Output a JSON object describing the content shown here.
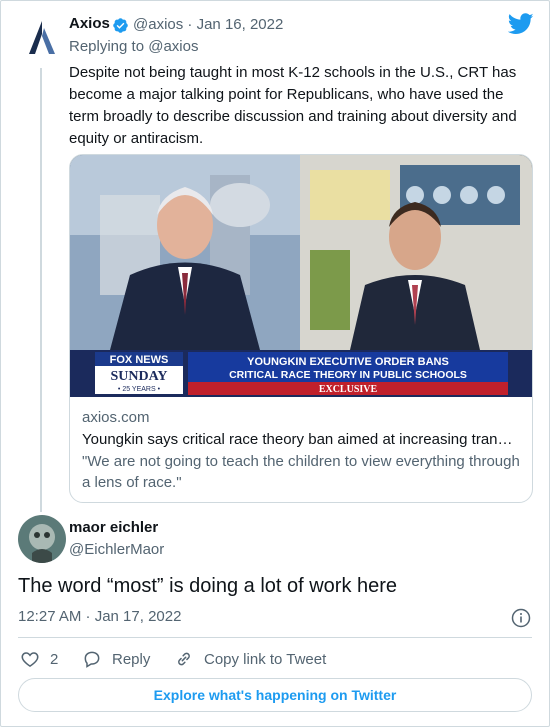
{
  "tweet": {
    "author_name": "Axios",
    "author_handle": "@axios",
    "date_sep": " · ",
    "date": "Jan 16, 2022",
    "replying_to": "Replying to @axios",
    "text": "Despite not being taught in most K-12 schools in the U.S., CRT has become a major talking point for Republicans, who have used the term broadly to describe discussion and training about diversity and equity or antiracism.",
    "logo_letter": "A",
    "card": {
      "image_banner_main": "YOUNGKIN EXECUTIVE ORDER BANS",
      "image_banner_sub": "CRITICAL RACE THEORY IN PUBLIC SCHOOLS",
      "image_banner_exclusive": "EXCLUSIVE",
      "image_network": "FOX NEWS",
      "image_show": "SUNDAY",
      "image_years": "• 25 YEARS •",
      "domain": "axios.com",
      "title": "Youngkin says critical race theory ban aimed at increasing tran…",
      "description": "\"We are not going to teach the children to view everything through a lens of race.\""
    }
  },
  "quote": {
    "author_name": "maor eichler",
    "author_handle": "@EichlerMaor",
    "text": "The word “most” is doing a lot of work here",
    "timestamp": "12:27 AM · Jan 17, 2022"
  },
  "actions": {
    "like_count": "2",
    "reply_label": "Reply",
    "copy_link_label": "Copy link to Tweet"
  },
  "explore_label": "Explore what's happening on Twitter",
  "icons": {
    "verified": "verified-badge-icon",
    "twitter": "twitter-bird-icon",
    "info": "info-icon",
    "like": "heart-icon",
    "reply": "reply-bubble-icon",
    "link": "link-icon"
  },
  "colors": {
    "twitter_blue": "#1d9bf0",
    "text": "#0f1419",
    "muted": "#536471",
    "border": "#cfd9de",
    "axios_logo": "#1a2d4d"
  }
}
